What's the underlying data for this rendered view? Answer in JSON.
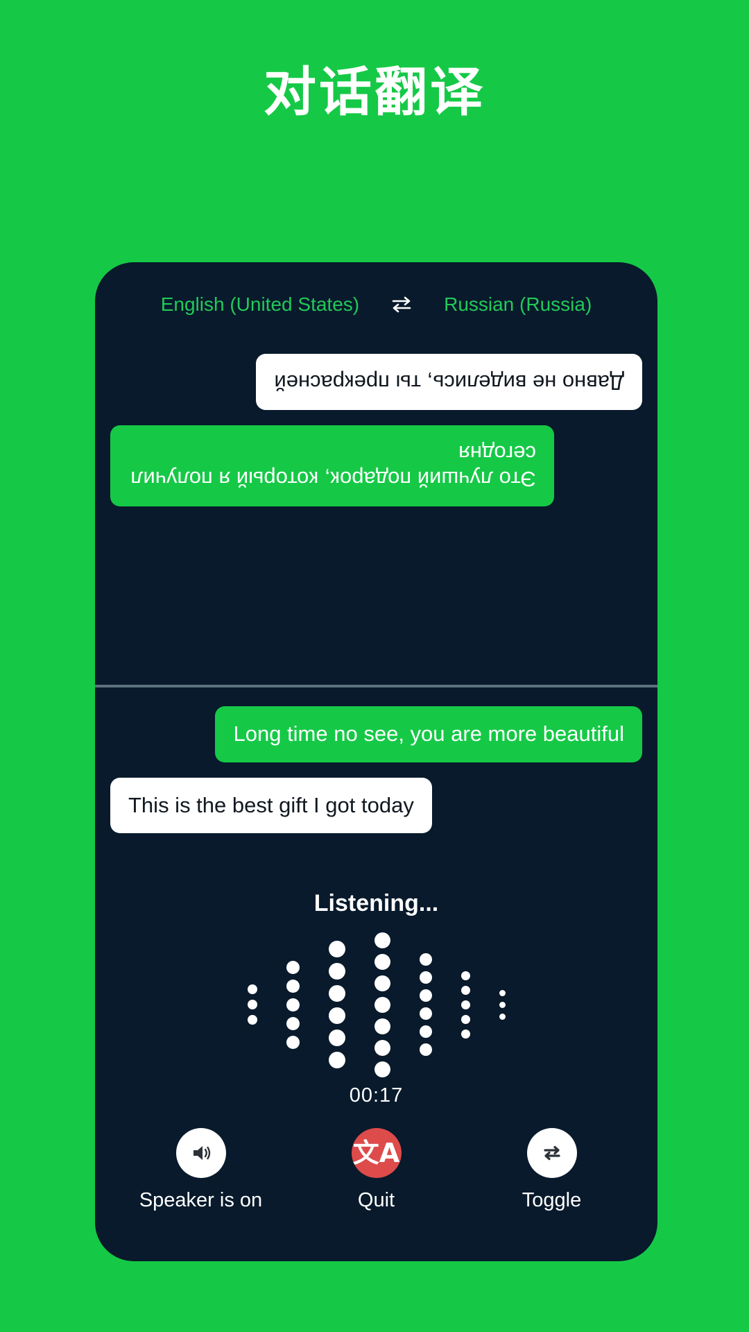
{
  "page": {
    "title": "对话翻译",
    "background_color": "#15C946",
    "card_color": "#081A2B",
    "accent_green": "#15C946",
    "chip_green": "#22C95A",
    "quit_red": "#DE4B4B"
  },
  "languages": {
    "source": "English (United States)",
    "swap_icon": "swap-horizontal-icon",
    "target": "Russian (Russia)"
  },
  "conversation": {
    "top_panel_rotated": true,
    "top_messages": [
      {
        "text": "Это лучший подарок, который я получил сегодня",
        "style": "green",
        "align": "right"
      },
      {
        "text": "Давно не виделись, ты прекрасней",
        "style": "white",
        "align": "left"
      }
    ],
    "bottom_messages": [
      {
        "text": "Long time no see, you are more beautiful",
        "style": "green",
        "align": "right"
      },
      {
        "text": "This is the best gift I got today",
        "style": "white",
        "align": "left"
      }
    ]
  },
  "recorder": {
    "status": "Listening...",
    "timer": "00:17",
    "waveform": {
      "columns": [
        {
          "count": 3,
          "size": 14
        },
        {
          "count": 5,
          "size": 19
        },
        {
          "count": 6,
          "size": 24
        },
        {
          "count": 7,
          "size": 23
        },
        {
          "count": 6,
          "size": 18
        },
        {
          "count": 5,
          "size": 13
        },
        {
          "count": 3,
          "size": 9
        }
      ]
    }
  },
  "actions": [
    {
      "name": "speaker",
      "label": "Speaker is on",
      "icon": "speaker-on-icon",
      "circle": "light"
    },
    {
      "name": "quit",
      "label": "Quit",
      "icon": "translate-icon",
      "circle": "red",
      "glyph": "文A"
    },
    {
      "name": "toggle",
      "label": "Toggle",
      "icon": "repeat-swap-icon",
      "circle": "light"
    }
  ]
}
